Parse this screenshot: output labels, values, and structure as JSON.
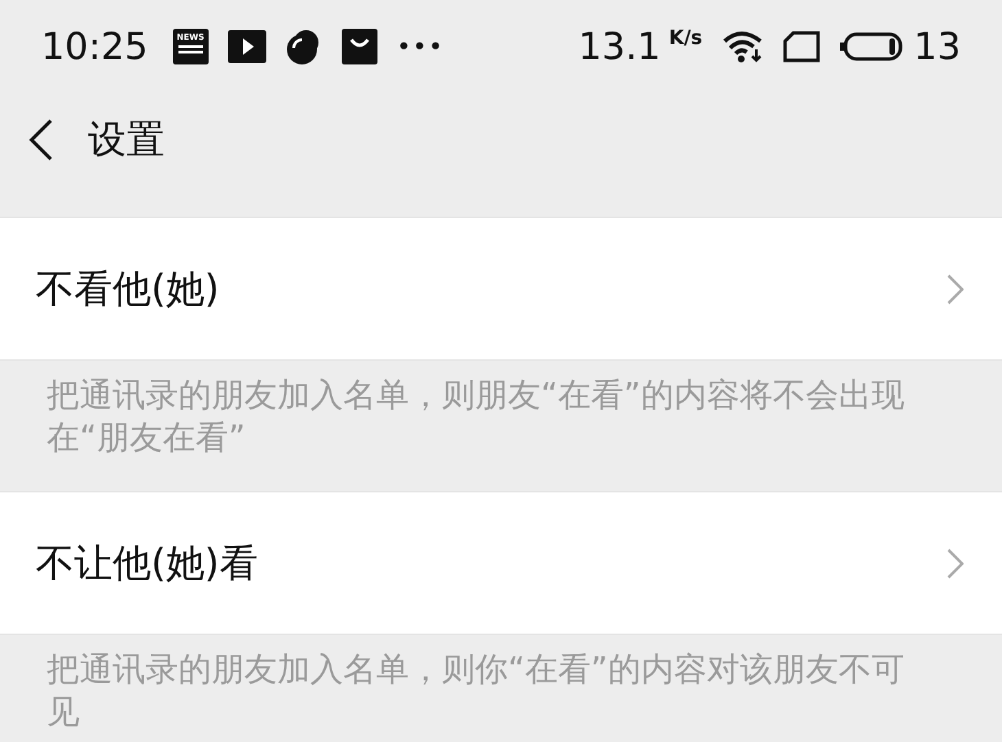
{
  "status_bar": {
    "time": "10:25",
    "news_icon_label": "NEWS",
    "more": "•••",
    "speed": "13.1",
    "speed_unit": "K/s",
    "battery": "13"
  },
  "header": {
    "title": "设置"
  },
  "sections": [
    {
      "label": "不看他(她)",
      "description": "把通讯录的朋友加入名单，则朋友“在看”的内容将不会出现在“朋友在看”"
    },
    {
      "label": "不让他(她)看",
      "description": "把通讯录的朋友加入名单，则你“在看”的内容对该朋友不可见"
    }
  ]
}
